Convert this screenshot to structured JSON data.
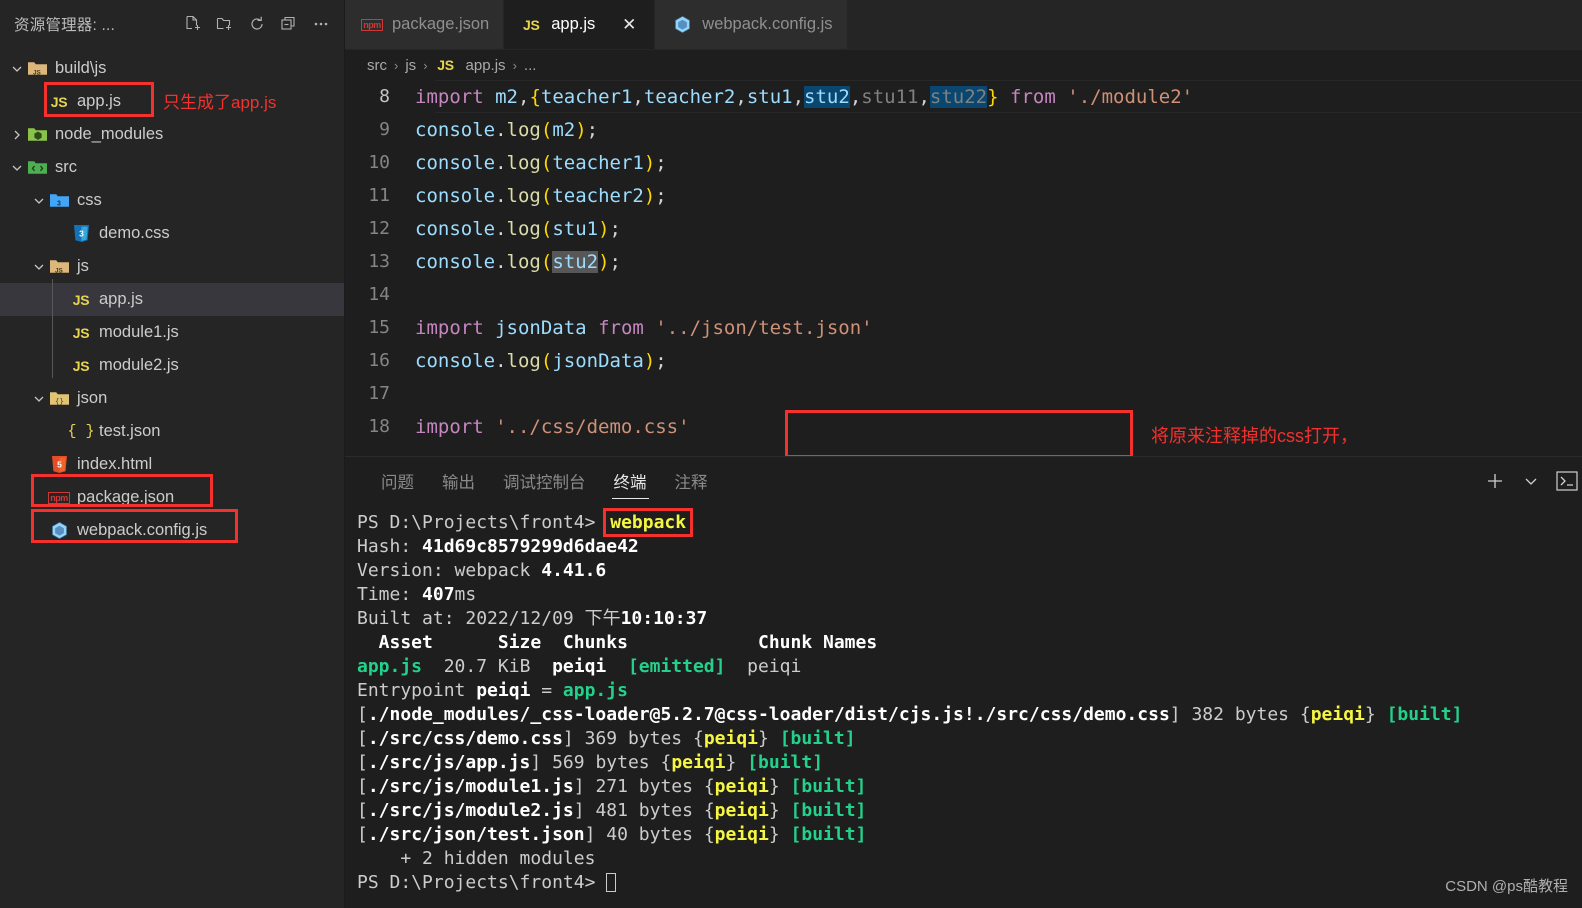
{
  "sidebar": {
    "title": "资源管理器: ...",
    "header_icons": [
      {
        "name": "new-file-icon",
        "label": "新建文件"
      },
      {
        "name": "new-folder-icon",
        "label": "新建文件夹"
      },
      {
        "name": "refresh-icon",
        "label": "刷新资源管理器"
      },
      {
        "name": "collapse-all-icon",
        "label": "在资源管理器中折叠文件夹"
      },
      {
        "name": "more-actions-icon",
        "label": "视图和更多操作..."
      }
    ],
    "tree": [
      {
        "label": "build\\js",
        "depth": 0,
        "type": "folder-js",
        "expanded": true,
        "icon": "folder-js-icon"
      },
      {
        "label": "app.js",
        "depth": 1,
        "type": "file-js",
        "icon": "js-file-icon",
        "boxed": true,
        "annotation": "只生成了app.js"
      },
      {
        "label": "node_modules",
        "depth": 0,
        "type": "folder-node",
        "expanded": false,
        "icon": "folder-node-icon"
      },
      {
        "label": "src",
        "depth": 0,
        "type": "folder-src",
        "expanded": true,
        "icon": "folder-src-icon"
      },
      {
        "label": "css",
        "depth": 1,
        "type": "folder-css",
        "expanded": true,
        "icon": "folder-css-icon"
      },
      {
        "label": "demo.css",
        "depth": 2,
        "type": "file-css",
        "icon": "css-file-icon"
      },
      {
        "label": "js",
        "depth": 1,
        "type": "folder-js",
        "expanded": true,
        "icon": "folder-js-icon"
      },
      {
        "label": "app.js",
        "depth": 2,
        "type": "file-js",
        "icon": "js-file-icon",
        "selected": true
      },
      {
        "label": "module1.js",
        "depth": 2,
        "type": "file-js",
        "icon": "js-file-icon"
      },
      {
        "label": "module2.js",
        "depth": 2,
        "type": "file-js",
        "icon": "js-file-icon"
      },
      {
        "label": "json",
        "depth": 1,
        "type": "folder-json",
        "expanded": true,
        "icon": "folder-json-icon"
      },
      {
        "label": "test.json",
        "depth": 2,
        "type": "file-json",
        "icon": "json-file-icon"
      },
      {
        "label": "index.html",
        "depth": 1,
        "type": "file-html",
        "icon": "html-file-icon"
      },
      {
        "label": "package.json",
        "depth": 1,
        "type": "file-npm",
        "icon": "npm-file-icon",
        "boxed": true
      },
      {
        "label": "webpack.config.js",
        "depth": 1,
        "type": "file-webpack",
        "icon": "webpack-file-icon",
        "boxed": true
      }
    ]
  },
  "tabs": [
    {
      "label": "package.json",
      "icon": "npm-file-icon",
      "active": false,
      "closable": false
    },
    {
      "label": "app.js",
      "icon": "js-file-icon",
      "active": true,
      "closable": true,
      "close_label": "✕"
    },
    {
      "label": "webpack.config.js",
      "icon": "webpack-file-icon",
      "active": false,
      "closable": false
    }
  ],
  "breadcrumb": {
    "items": [
      "src",
      "js",
      "app.js",
      "..."
    ],
    "separator": "›",
    "file_icon": "js-file-icon"
  },
  "editor": {
    "language": "javascript",
    "lines": [
      {
        "num": "8",
        "current": true,
        "tokens": [
          {
            "t": "import",
            "c": "t-kw"
          },
          {
            "t": " ",
            "c": "t-pun"
          },
          {
            "t": "m2",
            "c": "t-var"
          },
          {
            "t": ",",
            "c": "t-pun"
          },
          {
            "t": "{",
            "c": "t-brc"
          },
          {
            "t": "teacher1",
            "c": "t-var"
          },
          {
            "t": ",",
            "c": "t-pun"
          },
          {
            "t": "teacher2",
            "c": "t-var"
          },
          {
            "t": ",",
            "c": "t-pun"
          },
          {
            "t": "stu1",
            "c": "t-var"
          },
          {
            "t": ",",
            "c": "t-pun"
          },
          {
            "t": "stu2",
            "c": "t-var",
            "hl": "sel"
          },
          {
            "t": ",",
            "c": "t-pun"
          },
          {
            "t": "stu11",
            "c": "t-dim"
          },
          {
            "t": ",",
            "c": "t-pun"
          },
          {
            "t": "stu22",
            "c": "t-dim",
            "hl": "sel"
          },
          {
            "t": "}",
            "c": "t-brc"
          },
          {
            "t": " ",
            "c": "t-pun"
          },
          {
            "t": "from",
            "c": "t-kw"
          },
          {
            "t": " ",
            "c": "t-pun"
          },
          {
            "t": "'./module2'",
            "c": "t-str"
          }
        ]
      },
      {
        "num": "9",
        "tokens": [
          {
            "t": "console",
            "c": "t-var"
          },
          {
            "t": ".",
            "c": "t-pun"
          },
          {
            "t": "log",
            "c": "t-fn"
          },
          {
            "t": "(",
            "c": "t-brc"
          },
          {
            "t": "m2",
            "c": "t-var"
          },
          {
            "t": ")",
            "c": "t-brc"
          },
          {
            "t": ";",
            "c": "t-pun"
          }
        ]
      },
      {
        "num": "10",
        "tokens": [
          {
            "t": "console",
            "c": "t-var"
          },
          {
            "t": ".",
            "c": "t-pun"
          },
          {
            "t": "log",
            "c": "t-fn"
          },
          {
            "t": "(",
            "c": "t-brc"
          },
          {
            "t": "teacher1",
            "c": "t-var"
          },
          {
            "t": ")",
            "c": "t-brc"
          },
          {
            "t": ";",
            "c": "t-pun"
          }
        ]
      },
      {
        "num": "11",
        "tokens": [
          {
            "t": "console",
            "c": "t-var"
          },
          {
            "t": ".",
            "c": "t-pun"
          },
          {
            "t": "log",
            "c": "t-fn"
          },
          {
            "t": "(",
            "c": "t-brc"
          },
          {
            "t": "teacher2",
            "c": "t-var"
          },
          {
            "t": ")",
            "c": "t-brc"
          },
          {
            "t": ";",
            "c": "t-pun"
          }
        ]
      },
      {
        "num": "12",
        "tokens": [
          {
            "t": "console",
            "c": "t-var"
          },
          {
            "t": ".",
            "c": "t-pun"
          },
          {
            "t": "log",
            "c": "t-fn"
          },
          {
            "t": "(",
            "c": "t-brc"
          },
          {
            "t": "stu1",
            "c": "t-var"
          },
          {
            "t": ")",
            "c": "t-brc"
          },
          {
            "t": ";",
            "c": "t-pun"
          }
        ]
      },
      {
        "num": "13",
        "tokens": [
          {
            "t": "console",
            "c": "t-var"
          },
          {
            "t": ".",
            "c": "t-pun"
          },
          {
            "t": "log",
            "c": "t-fn"
          },
          {
            "t": "(",
            "c": "t-brc"
          },
          {
            "t": "stu2",
            "c": "t-var",
            "hl": "wordhl"
          },
          {
            "t": ")",
            "c": "t-brc"
          },
          {
            "t": ";",
            "c": "t-pun"
          }
        ]
      },
      {
        "num": "14",
        "tokens": []
      },
      {
        "num": "15",
        "tokens": [
          {
            "t": "import",
            "c": "t-kw"
          },
          {
            "t": " ",
            "c": "t-pun"
          },
          {
            "t": "jsonData",
            "c": "t-var"
          },
          {
            "t": " ",
            "c": "t-pun"
          },
          {
            "t": "from",
            "c": "t-kw"
          },
          {
            "t": " ",
            "c": "t-pun"
          },
          {
            "t": "'../json/test.json'",
            "c": "t-str"
          }
        ]
      },
      {
        "num": "16",
        "tokens": [
          {
            "t": "console",
            "c": "t-var"
          },
          {
            "t": ".",
            "c": "t-pun"
          },
          {
            "t": "log",
            "c": "t-fn"
          },
          {
            "t": "(",
            "c": "t-brc"
          },
          {
            "t": "jsonData",
            "c": "t-var"
          },
          {
            "t": ")",
            "c": "t-brc"
          },
          {
            "t": ";",
            "c": "t-pun"
          }
        ]
      },
      {
        "num": "17",
        "tokens": []
      },
      {
        "num": "18",
        "tokens": [
          {
            "t": "import",
            "c": "t-kw"
          },
          {
            "t": " ",
            "c": "t-pun"
          },
          {
            "t": "'../css/demo.css'",
            "c": "t-str"
          }
        ]
      }
    ],
    "annotation": "将原来注释掉的css打开，"
  },
  "panel": {
    "tabs": [
      {
        "label": "问题",
        "active": false
      },
      {
        "label": "输出",
        "active": false
      },
      {
        "label": "调试控制台",
        "active": false
      },
      {
        "label": "终端",
        "active": true
      },
      {
        "label": "注释",
        "active": false
      }
    ],
    "actions": [
      {
        "name": "new-terminal-icon",
        "glyph": "+"
      },
      {
        "name": "chevron-down-icon",
        "glyph": "⌄"
      },
      {
        "name": "terminal-shell-icon",
        "glyph": ">_"
      }
    ],
    "terminal": {
      "highlighted_command": "webpack",
      "lines": [
        {
          "id": "prompt-run",
          "segs": [
            {
              "t": "PS D:\\Projects\\front4> ",
              "c": "g-grey"
            },
            {
              "t": "webpack",
              "c": "g-yellow",
              "box": true
            }
          ]
        },
        {
          "id": "hash",
          "segs": [
            {
              "t": "Hash: ",
              "c": "g-grey"
            },
            {
              "t": "41d69c8579299d6dae42",
              "c": "g-bwhite"
            }
          ]
        },
        {
          "id": "version",
          "segs": [
            {
              "t": "Version: webpack ",
              "c": "g-grey"
            },
            {
              "t": "4.41.6",
              "c": "g-bwhite"
            }
          ]
        },
        {
          "id": "time",
          "segs": [
            {
              "t": "Time: ",
              "c": "g-grey"
            },
            {
              "t": "407",
              "c": "g-bwhite"
            },
            {
              "t": "ms",
              "c": "g-grey"
            }
          ]
        },
        {
          "id": "built-at",
          "segs": [
            {
              "t": "Built at: 2022/12/09 下午",
              "c": "g-grey"
            },
            {
              "t": "10:10:37",
              "c": "g-bwhite"
            }
          ]
        },
        {
          "id": "table-header",
          "segs": [
            {
              "t": "  Asset      Size  Chunks",
              "c": "g-bwhite"
            },
            {
              "t": "            ",
              "c": "g-grey"
            },
            {
              "t": "Chunk Names",
              "c": "g-bwhite"
            }
          ]
        },
        {
          "id": "asset-row",
          "segs": [
            {
              "t": "app.js",
              "c": "g-bgreen"
            },
            {
              "t": "  20.7 KiB  ",
              "c": "g-grey"
            },
            {
              "t": "peiqi",
              "c": "g-bwhite"
            },
            {
              "t": "  ",
              "c": "g-grey"
            },
            {
              "t": "[emitted]",
              "c": "g-bgreen"
            },
            {
              "t": "  peiqi",
              "c": "g-grey"
            }
          ]
        },
        {
          "id": "entrypoint",
          "segs": [
            {
              "t": "Entrypoint ",
              "c": "g-grey"
            },
            {
              "t": "peiqi",
              "c": "g-bwhite"
            },
            {
              "t": " = ",
              "c": "g-grey"
            },
            {
              "t": "app.js",
              "c": "g-bgreen"
            }
          ]
        },
        {
          "id": "module-cssloader",
          "segs": [
            {
              "t": "[",
              "c": "g-grey"
            },
            {
              "t": "./node_modules/_css-loader@5.2.7@css-loader/dist/cjs.js!./src/css/demo.css",
              "c": "g-bwhite"
            },
            {
              "t": "] ",
              "c": "g-grey"
            },
            {
              "t": "382 bytes ",
              "c": "g-grey"
            },
            {
              "t": "{",
              "c": "g-grey"
            },
            {
              "t": "peiqi",
              "c": "g-yellow"
            },
            {
              "t": "} ",
              "c": "g-grey"
            },
            {
              "t": "[built]",
              "c": "g-bgreen"
            }
          ]
        },
        {
          "id": "module-democss",
          "segs": [
            {
              "t": "[",
              "c": "g-grey"
            },
            {
              "t": "./src/css/demo.css",
              "c": "g-bwhite"
            },
            {
              "t": "] ",
              "c": "g-grey"
            },
            {
              "t": "369 bytes ",
              "c": "g-grey"
            },
            {
              "t": "{",
              "c": "g-grey"
            },
            {
              "t": "peiqi",
              "c": "g-yellow"
            },
            {
              "t": "} ",
              "c": "g-grey"
            },
            {
              "t": "[built]",
              "c": "g-bgreen"
            }
          ]
        },
        {
          "id": "module-appjs",
          "segs": [
            {
              "t": "[",
              "c": "g-grey"
            },
            {
              "t": "./src/js/app.js",
              "c": "g-bwhite"
            },
            {
              "t": "] ",
              "c": "g-grey"
            },
            {
              "t": "569 bytes ",
              "c": "g-grey"
            },
            {
              "t": "{",
              "c": "g-grey"
            },
            {
              "t": "peiqi",
              "c": "g-yellow"
            },
            {
              "t": "} ",
              "c": "g-grey"
            },
            {
              "t": "[built]",
              "c": "g-bgreen"
            }
          ]
        },
        {
          "id": "module-module1",
          "segs": [
            {
              "t": "[",
              "c": "g-grey"
            },
            {
              "t": "./src/js/module1.js",
              "c": "g-bwhite"
            },
            {
              "t": "] ",
              "c": "g-grey"
            },
            {
              "t": "271 bytes ",
              "c": "g-grey"
            },
            {
              "t": "{",
              "c": "g-grey"
            },
            {
              "t": "peiqi",
              "c": "g-yellow"
            },
            {
              "t": "} ",
              "c": "g-grey"
            },
            {
              "t": "[built]",
              "c": "g-bgreen"
            }
          ]
        },
        {
          "id": "module-module2",
          "segs": [
            {
              "t": "[",
              "c": "g-grey"
            },
            {
              "t": "./src/js/module2.js",
              "c": "g-bwhite"
            },
            {
              "t": "] ",
              "c": "g-grey"
            },
            {
              "t": "481 bytes ",
              "c": "g-grey"
            },
            {
              "t": "{",
              "c": "g-grey"
            },
            {
              "t": "peiqi",
              "c": "g-yellow"
            },
            {
              "t": "} ",
              "c": "g-grey"
            },
            {
              "t": "[built]",
              "c": "g-bgreen"
            }
          ]
        },
        {
          "id": "module-testjson",
          "segs": [
            {
              "t": "[",
              "c": "g-grey"
            },
            {
              "t": "./src/json/test.json",
              "c": "g-bwhite"
            },
            {
              "t": "] ",
              "c": "g-grey"
            },
            {
              "t": "40 bytes ",
              "c": "g-grey"
            },
            {
              "t": "{",
              "c": "g-grey"
            },
            {
              "t": "peiqi",
              "c": "g-yellow"
            },
            {
              "t": "} ",
              "c": "g-grey"
            },
            {
              "t": "[built]",
              "c": "g-bgreen"
            }
          ]
        },
        {
          "id": "hidden-modules",
          "segs": [
            {
              "t": "    + 2 hidden modules",
              "c": "g-grey"
            }
          ]
        },
        {
          "id": "prompt-idle",
          "segs": [
            {
              "t": "PS D:\\Projects\\front4> ",
              "c": "g-grey"
            },
            {
              "t": "",
              "c": "g-grey",
              "cursor": true
            }
          ]
        }
      ]
    }
  },
  "watermark": "CSDN @ps酷教程",
  "colors": {
    "accent_red": "#f5312d",
    "selection_blue": "#094771",
    "sidebar_bg": "#252526",
    "editor_bg": "#1e1e1e",
    "terminal_green": "#23d18b",
    "terminal_yellow": "#f5f543"
  }
}
